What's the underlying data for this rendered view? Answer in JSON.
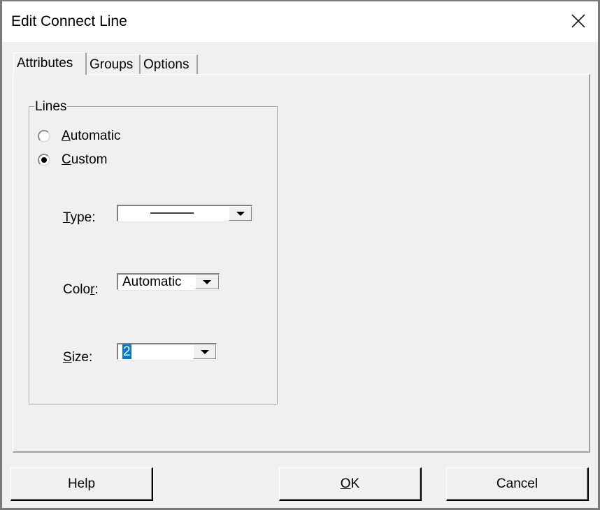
{
  "window": {
    "title": "Edit Connect Line",
    "close_icon": "close-icon"
  },
  "tabs": [
    {
      "label": "Attributes",
      "active": true
    },
    {
      "label": "Groups",
      "active": false
    },
    {
      "label": "Options",
      "active": false
    }
  ],
  "lines_group": {
    "legend": "Lines",
    "radios": [
      {
        "label": "Automatic",
        "mnemonic": "A",
        "rest": "utomatic",
        "checked": false
      },
      {
        "label": "Custom",
        "mnemonic": "C",
        "rest": "ustom",
        "checked": true
      }
    ],
    "type": {
      "label": "Type:",
      "mnemonic": "T",
      "rest": "ype:",
      "value": "solid-line"
    },
    "color": {
      "label": "Color:",
      "before": "Colo",
      "mnemonic": "r",
      "rest": ":",
      "value": "Automatic"
    },
    "size": {
      "label": "Size:",
      "mnemonic": "S",
      "rest": "ize:",
      "value": "2"
    }
  },
  "buttons": {
    "help": "Help",
    "ok": {
      "label": "OK",
      "mnemonic": "O",
      "rest": "K"
    },
    "cancel": "Cancel"
  },
  "colors": {
    "selection": "#0078d7",
    "dialog_bg": "#f0f0f0",
    "titlebar_bg": "#ffffff"
  }
}
